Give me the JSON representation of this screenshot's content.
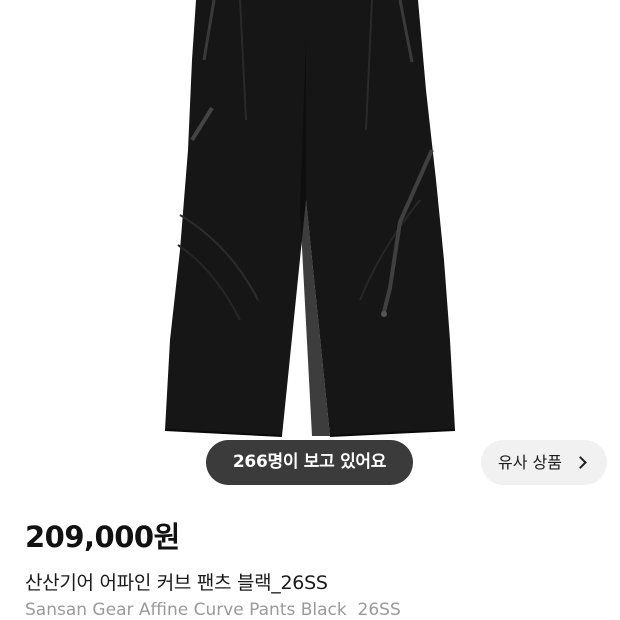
{
  "product": {
    "viewers_text": "266명이 보고 있어요",
    "similar_button_label": "유사 상품",
    "price": "209,000원",
    "title_kr": "산산기어 어파인 커브 팬츠 블랙_26SS",
    "title_en": "Sansan Gear Affine Curve Pants Black  26SS"
  },
  "icons": {
    "similar_chevron": "chevron-right-icon"
  },
  "colors": {
    "pill_background": "#3b3b3b",
    "button_background": "#f1f1f1",
    "garment": "#161616"
  }
}
